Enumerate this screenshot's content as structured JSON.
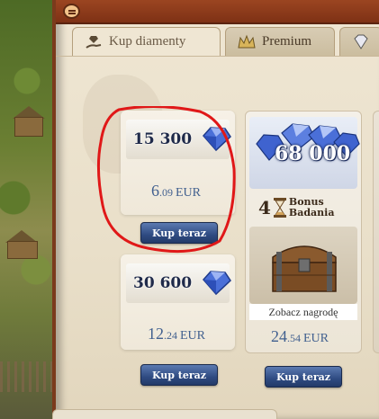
{
  "tabs": [
    {
      "label": "Kup diamenty",
      "icon": "hand-diamond-icon",
      "active": true
    },
    {
      "label": "Premium",
      "icon": "crown-icon",
      "active": false
    },
    {
      "label": "",
      "icon": "diamond-icon",
      "active": false
    }
  ],
  "offers": [
    {
      "amount": "15 300",
      "price_major": "6",
      "price_minor": ".09",
      "currency": "EUR",
      "button": "Kup teraz"
    },
    {
      "amount": "30 600",
      "price_major": "12",
      "price_minor": ".24",
      "currency": "EUR",
      "button": "Kup teraz"
    },
    {
      "amount": "68 000",
      "bonus_count": "4",
      "bonus_line1": "Bonus",
      "bonus_line2": "Badania",
      "reward_link": "Zobacz nagrodę",
      "price_major": "24",
      "price_minor": ".54",
      "currency": "EUR",
      "button": "Kup teraz"
    }
  ],
  "colors": {
    "annotation": "#e01818",
    "button": "#2f4b82",
    "price": "#41608f",
    "topbar": "#8a3a1a"
  }
}
